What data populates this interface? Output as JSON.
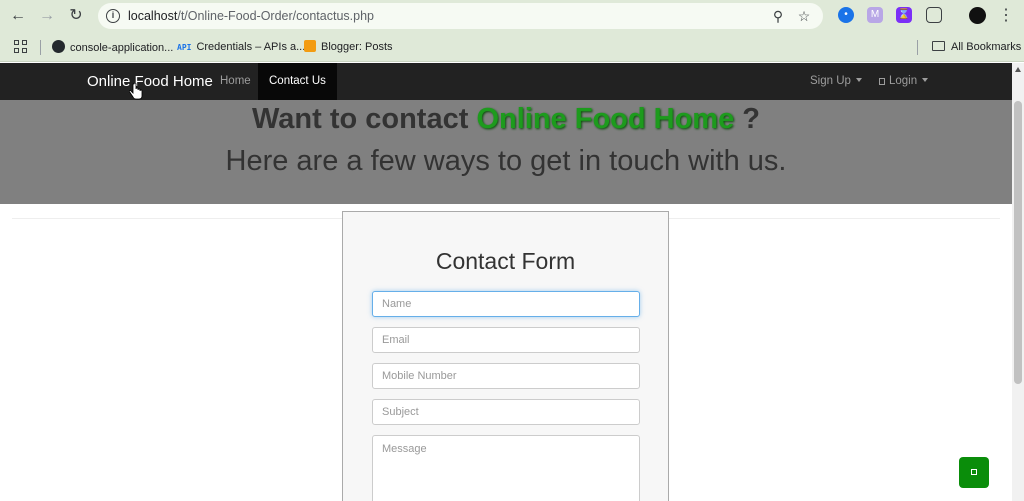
{
  "browser": {
    "url_host": "localhost",
    "url_path": "/t/Online-Food-Order/contactus.php",
    "bookmarks": [
      {
        "label": "console-application..."
      },
      {
        "label": "Credentials – APIs a...",
        "badge": "API"
      },
      {
        "label": "Blogger: Posts"
      }
    ],
    "all_bookmarks_label": "All Bookmarks",
    "extensions": [
      {
        "icon": "ext-blue-icon",
        "color": "#1a73e8"
      },
      {
        "icon": "ext-m-icon",
        "color": "#8b6fd6",
        "letter": "M"
      },
      {
        "icon": "ext-hourglass-icon",
        "color": "#7b2ff7"
      }
    ]
  },
  "navbar": {
    "brand": "Online Food Home",
    "links": [
      {
        "label": "Home",
        "active": false
      },
      {
        "label": "Contact Us",
        "active": true
      }
    ],
    "signup_label": "Sign Up",
    "login_label": "Login"
  },
  "hero": {
    "line1_prefix": "Want to contact",
    "line1_brand": "Online Food Home",
    "line1_suffix": "?",
    "line2": "Here are a few ways to get in touch with us."
  },
  "contact_form": {
    "title": "Contact Form",
    "fields": {
      "name_placeholder": "Name",
      "email_placeholder": "Email",
      "mobile_placeholder": "Mobile Number",
      "subject_placeholder": "Subject",
      "message_placeholder": "Message"
    }
  },
  "colors": {
    "navbar_bg": "#222222",
    "hero_bg": "#808080",
    "brand_green": "#1d9b1d",
    "chat_button": "#0a8d0a"
  }
}
